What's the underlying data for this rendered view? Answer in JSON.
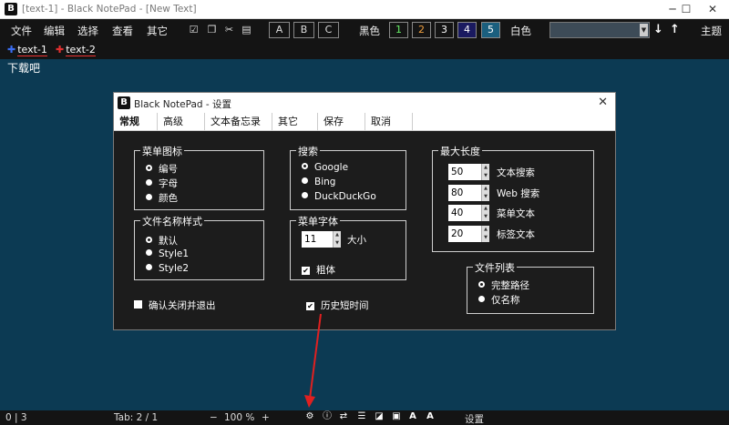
{
  "window": {
    "app_icon": "B",
    "title": "[text-1] - Black NotePad - [New Text]",
    "buttons": {
      "minimize": "─",
      "maximize": "☐",
      "close": "✕"
    }
  },
  "toolbar": {
    "menus": [
      "文件",
      "编辑",
      "选择",
      "查看",
      "其它"
    ],
    "icons": [
      "checkbox-icon",
      "copy-icon",
      "cut-icon",
      "paste-icon"
    ],
    "abc": [
      "A",
      "B",
      "C"
    ],
    "black_label": "黑色",
    "theme_numbers": [
      {
        "n": "1",
        "color": "#66ee66"
      },
      {
        "n": "2",
        "color": "#f0a040"
      },
      {
        "n": "3",
        "color": "#ffffff"
      },
      {
        "n": "4",
        "color": "#ffffff"
      },
      {
        "n": "5",
        "color": "#ffffff"
      }
    ],
    "white_label": "白色",
    "arrows": [
      "↓",
      "↑"
    ],
    "home_label": "主题"
  },
  "tabs": [
    {
      "label": "text-1",
      "color": "#3a6cf0"
    },
    {
      "label": "text-2",
      "color": "#e03030"
    }
  ],
  "editor": {
    "content": "下载吧"
  },
  "dialog": {
    "app_icon": "B",
    "title": "Black NotePad - 设置",
    "close": "✕",
    "tabs": [
      "常规",
      "高级",
      "文本备忘录",
      "其它",
      "保存",
      "取消"
    ],
    "menu_icon": {
      "title": "菜单图标",
      "options": [
        "编号",
        "字母",
        "颜色"
      ]
    },
    "file_style": {
      "title": "文件名称样式",
      "options": [
        "默认",
        "Style1",
        "Style2"
      ]
    },
    "search": {
      "title": "搜索",
      "options": [
        "Google",
        "Bing",
        "DuckDuckGo"
      ]
    },
    "menu_font": {
      "title": "菜单字体",
      "size_value": "11",
      "size_label": "大小",
      "bold_label": "粗体"
    },
    "max_length": {
      "title": "最大长度",
      "rows": [
        {
          "value": "50",
          "label": "文本搜索"
        },
        {
          "value": "80",
          "label": "Web 搜索"
        },
        {
          "value": "40",
          "label": "菜单文本"
        },
        {
          "value": "20",
          "label": "标签文本"
        }
      ]
    },
    "file_list": {
      "title": "文件列表",
      "options": [
        "完整路径",
        "仅名称"
      ]
    },
    "confirm_close": "确认关闭并退出",
    "history_short": "历史短时间"
  },
  "status": {
    "position": "0 | 3",
    "tab": "Tab: 2 / 1",
    "zoom_minus": "−",
    "zoom": "100 %",
    "zoom_plus": "+",
    "icons": [
      "settings-icon",
      "info-icon",
      "swap-icon",
      "list-icon",
      "contrast-icon",
      "word-wrap-icon",
      "font-increase-icon",
      "font-decrease-icon"
    ],
    "settings_label": "设置"
  }
}
